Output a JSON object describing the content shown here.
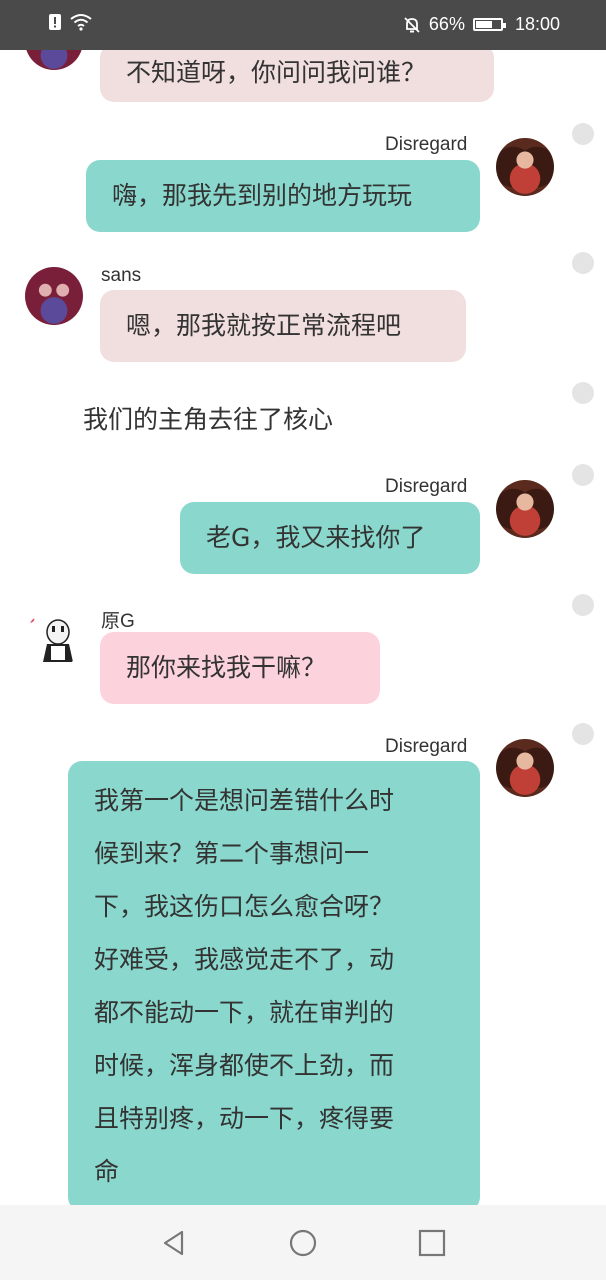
{
  "status_bar": {
    "battery_text": "66%",
    "battery_level": 0.66,
    "time": "18:00",
    "icons": [
      "sim-alert-icon",
      "wifi-icon",
      "mute-icon",
      "battery-icon"
    ]
  },
  "messages": [
    {
      "type": "bubble",
      "sender": "sans",
      "side": "left",
      "style": "pink",
      "text": "不知道呀，你问问我问谁？"
    },
    {
      "type": "bubble",
      "sender": "Disregard",
      "side": "right",
      "style": "teal",
      "name": "Disregard",
      "text": "嗨，那我先到别的地方玩玩"
    },
    {
      "type": "bubble",
      "sender": "sans",
      "side": "left",
      "style": "pink",
      "name": "sans",
      "text": "嗯，那我就按正常流程吧"
    },
    {
      "type": "narration",
      "text": "我们的主角去往了核心"
    },
    {
      "type": "bubble",
      "sender": "Disregard",
      "side": "right",
      "style": "teal",
      "name": "Disregard",
      "text": "老G，我又来找你了"
    },
    {
      "type": "bubble",
      "sender": "原G",
      "side": "left",
      "style": "pink2",
      "name": "原G",
      "text": "那你来找我干嘛？"
    },
    {
      "type": "bubble",
      "sender": "Disregard",
      "side": "right",
      "style": "teal",
      "name": "Disregard",
      "lines": [
        "我第一个是想问差错什么时",
        "候到来？第二个事想问一",
        "下，我这伤口怎么愈合呀？",
        "好难受，我感觉走不了，动",
        "都不能动一下，就在审判的",
        "时候，浑身都使不上劲，而",
        "且特别疼，动一下，疼得要",
        "命"
      ]
    }
  ],
  "colors": {
    "status_bar": "#4a4a4a",
    "pink_bubble": "#f1dede",
    "pink_bubble_alt": "#fcd3dc",
    "teal_bubble": "#8ad8cd",
    "nav_bar": "#f5f5f5"
  },
  "nav": {
    "icons": [
      "back-triangle-icon",
      "home-circle-icon",
      "recents-square-icon"
    ]
  }
}
